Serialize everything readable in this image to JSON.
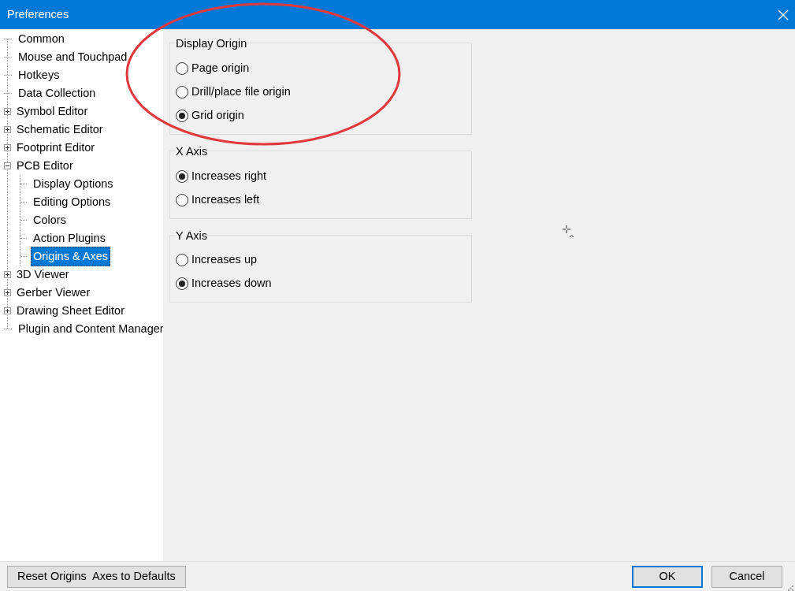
{
  "window": {
    "title": "Preferences"
  },
  "tree": [
    {
      "label": "Common",
      "kind": "leaf",
      "selected": false
    },
    {
      "label": "Mouse and Touchpad",
      "kind": "leaf",
      "selected": false
    },
    {
      "label": "Hotkeys",
      "kind": "leaf",
      "selected": false
    },
    {
      "label": "Data Collection",
      "kind": "leaf",
      "selected": false
    },
    {
      "label": "Symbol Editor",
      "kind": "branch",
      "expanded": false,
      "selected": false
    },
    {
      "label": "Schematic Editor",
      "kind": "branch",
      "expanded": false,
      "selected": false
    },
    {
      "label": "Footprint Editor",
      "kind": "branch",
      "expanded": false,
      "selected": false
    },
    {
      "label": "PCB Editor",
      "kind": "branch",
      "expanded": true,
      "selected": false,
      "children": [
        {
          "label": "Display Options",
          "kind": "leaf",
          "selected": false
        },
        {
          "label": "Editing Options",
          "kind": "leaf",
          "selected": false
        },
        {
          "label": "Colors",
          "kind": "leaf",
          "selected": false
        },
        {
          "label": "Action Plugins",
          "kind": "leaf",
          "selected": false
        },
        {
          "label": "Origins & Axes",
          "kind": "leaf",
          "selected": true
        }
      ]
    },
    {
      "label": "3D Viewer",
      "kind": "branch",
      "expanded": false,
      "selected": false
    },
    {
      "label": "Gerber Viewer",
      "kind": "branch",
      "expanded": false,
      "selected": false
    },
    {
      "label": "Drawing Sheet Editor",
      "kind": "branch",
      "expanded": false,
      "selected": false
    },
    {
      "label": "Plugin and Content Manager",
      "kind": "leaf",
      "selected": false
    }
  ],
  "groups": [
    {
      "title": "Display Origin",
      "options": [
        {
          "label": "Page origin",
          "selected": false
        },
        {
          "label": "Drill/place file origin",
          "selected": false
        },
        {
          "label": "Grid origin",
          "selected": true
        }
      ]
    },
    {
      "title": "X Axis",
      "options": [
        {
          "label": "Increases right",
          "selected": true
        },
        {
          "label": "Increases left",
          "selected": false
        }
      ]
    },
    {
      "title": "Y Axis",
      "options": [
        {
          "label": "Increases up",
          "selected": false
        },
        {
          "label": "Increases down",
          "selected": true
        }
      ]
    }
  ],
  "footer": {
    "reset_button": "Reset Origins  Axes to Defaults",
    "ok_button": "OK",
    "cancel_button": "Cancel"
  }
}
